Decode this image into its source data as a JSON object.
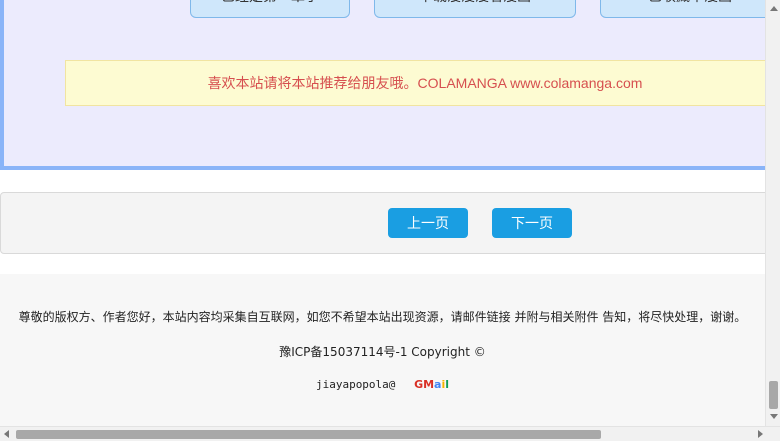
{
  "chips": [
    {
      "label": "已经是第一章了"
    },
    {
      "label": "下载漫漫漫看漫画"
    },
    {
      "label": "已收藏本漫画"
    }
  ],
  "notice": {
    "text": "喜欢本站请将本站推荐给朋友哦。COLAMANGA www.colamanga.com"
  },
  "pager": {
    "prev_label": "上一页",
    "next_label": "下一页"
  },
  "footer": {
    "disclaimer": "尊敬的版权方、作者您好，本站内容均采集自互联网，如您不希望本站出现资源，请邮件链接 并附与相关附件 告知，将尽快处理，谢谢。",
    "icp": "豫ICP备15037114号-1 Copyright ©",
    "email_user": "jiayapopola@",
    "gmail_letters": {
      "g": "G",
      "m": "M",
      "a": "a",
      "i": "i",
      "l": "l"
    }
  },
  "colors": {
    "panel_bg": "#ecebfd",
    "accent_border": "#8ab4f8",
    "button_blue": "#1a9ee2",
    "notice_text": "#d64f4f",
    "notice_bg": "#fdfbd2"
  }
}
